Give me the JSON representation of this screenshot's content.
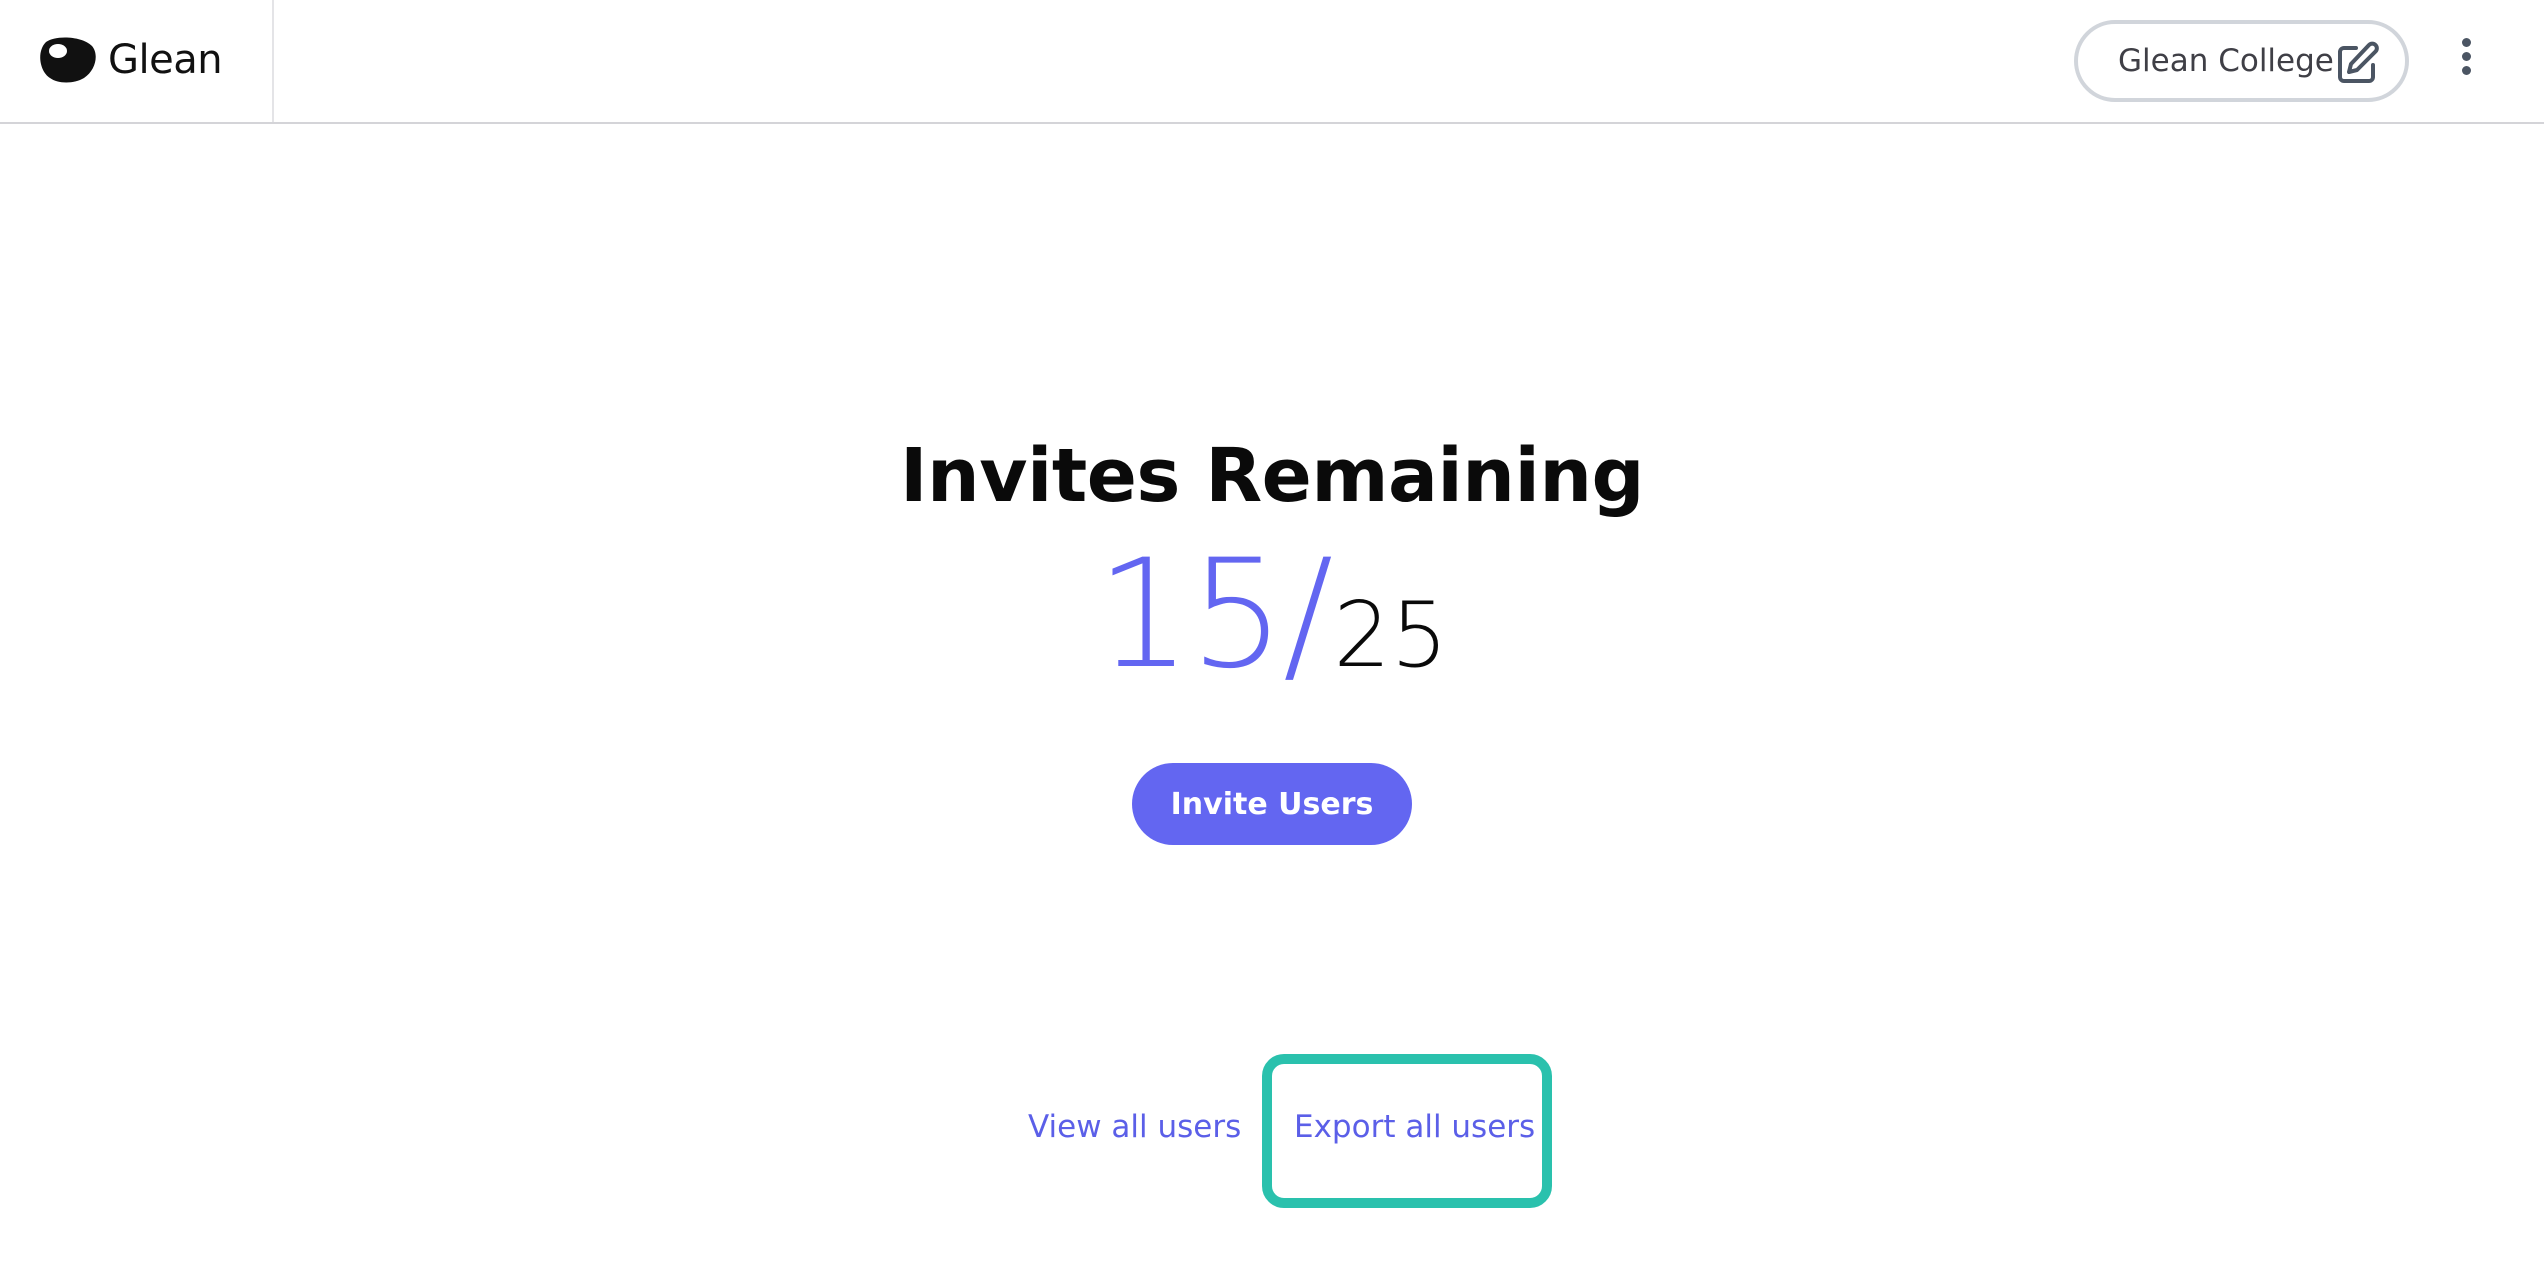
{
  "header": {
    "brand_name": "Glean",
    "brand_icon": "glean-logo-icon",
    "org_name": "Glean College",
    "org_edit_icon": "edit-icon",
    "more_menu_icon": "more-vertical-icon"
  },
  "main": {
    "title": "Invites Remaining",
    "invites_remaining": "15",
    "slash": "/",
    "invites_total": "25",
    "invite_button_label": "Invite Users"
  },
  "links": {
    "view_all_label": "View all users",
    "export_all_label": "Export all users"
  },
  "colors": {
    "accent": "#6366f1",
    "highlight": "#2ac1ad",
    "text": "#0a0a0a"
  }
}
